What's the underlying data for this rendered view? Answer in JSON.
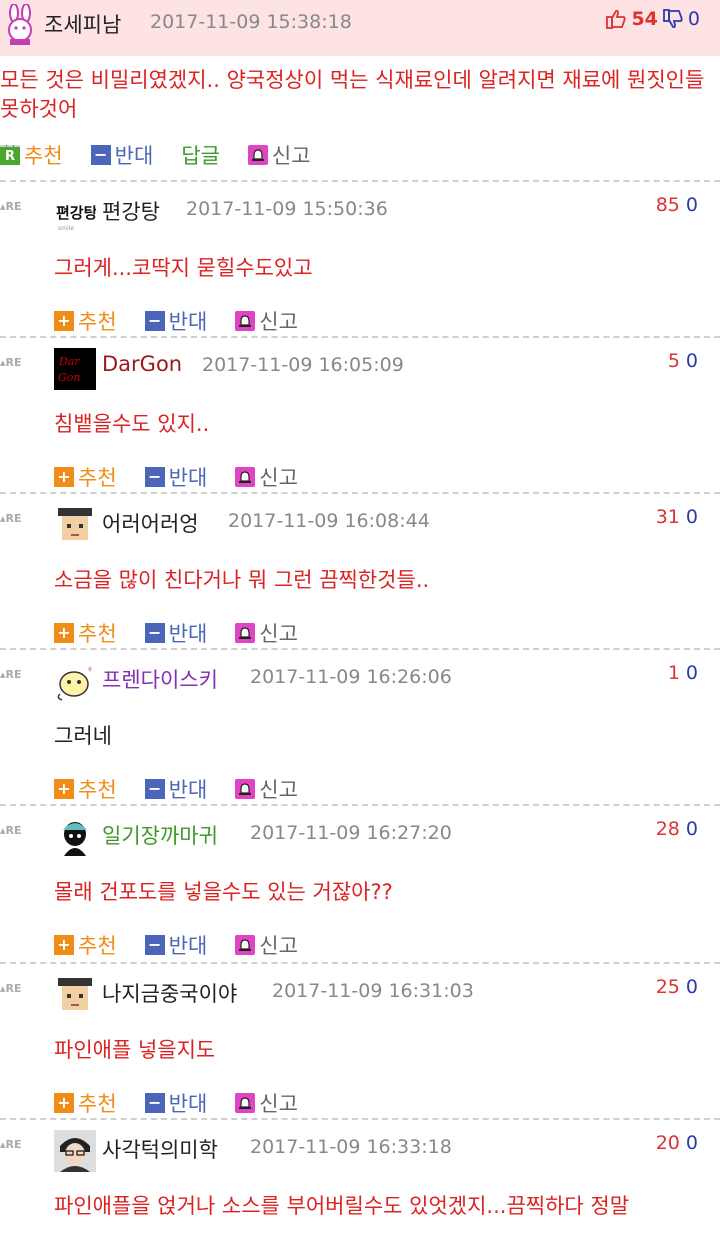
{
  "main": {
    "user": "조세피남",
    "date": "2017-11-09 15:38:18",
    "up": "54",
    "down": "0",
    "body": "모든 것은 비밀리였겠지.. 양국정상이 먹는 식재료인데 알려지면 재료에 뭔짓인들 못하것어",
    "actions": {
      "recommend": "추천",
      "oppose": "반대",
      "reply_icon": "R",
      "reply": "답글",
      "report": "신고"
    }
  },
  "re_label": "RE",
  "actions": {
    "recommend": "추천",
    "oppose": "반대",
    "report": "신고"
  },
  "colors": {
    "red": "#dd2222",
    "blue": "#2a3bb0",
    "orange": "#f08c18",
    "purple": "#8a2bb8",
    "green": "#3c9a2a",
    "header_bg": "#fde3e3"
  },
  "replies": [
    {
      "user": "편강탕",
      "date": "2017-11-09 15:50:36",
      "up": "85",
      "down": "0",
      "body": "그러게...코딱지 묻힐수도있고",
      "user_color": "#222222"
    },
    {
      "user": "DarGon",
      "date": "2017-11-09 16:05:09",
      "up": "5",
      "down": "0",
      "body": "침뱉을수도 있지..",
      "user_color": "#9a1a1a"
    },
    {
      "user": "어러어러엉",
      "date": "2017-11-09 16:08:44",
      "up": "31",
      "down": "0",
      "body": "소금을 많이 친다거나 뭐 그런 끔찍한것들..",
      "user_color": "#222222"
    },
    {
      "user": "프렌다이스키",
      "date": "2017-11-09 16:26:06",
      "up": "1",
      "down": "0",
      "body": "그러네",
      "user_color": "#8a2bb8"
    },
    {
      "user": "일기장까마귀",
      "date": "2017-11-09 16:27:20",
      "up": "28",
      "down": "0",
      "body": "몰래 건포도를 넣을수도 있는 거잖아??",
      "user_color": "#3c9a2a"
    },
    {
      "user": "나지금중국이야",
      "date": "2017-11-09 16:31:03",
      "up": "25",
      "down": "0",
      "body": "파인애플 넣을지도",
      "user_color": "#222222"
    },
    {
      "user": "사각턱의미학",
      "date": "2017-11-09 16:33:18",
      "up": "20",
      "down": "0",
      "body": "파인애플을 얹거나 소스를 부어버릴수도 있엇겠지...끔찍하다 정말",
      "user_color": "#222222"
    }
  ]
}
